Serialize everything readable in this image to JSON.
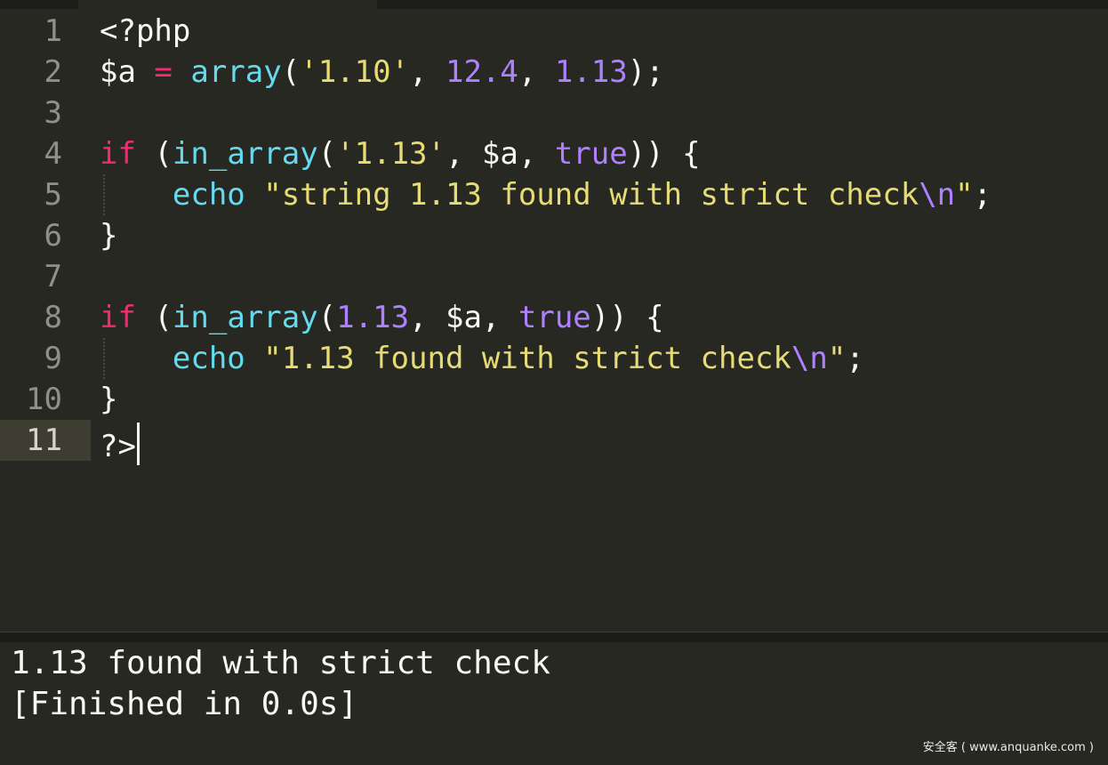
{
  "editor": {
    "active_line": 11,
    "lines": [
      {
        "number": "1",
        "tokens": [
          [
            "plain",
            "<?php"
          ]
        ]
      },
      {
        "number": "2",
        "tokens": [
          [
            "plain",
            "$a "
          ],
          [
            "kw",
            "="
          ],
          [
            "plain",
            " "
          ],
          [
            "fn",
            "array"
          ],
          [
            "plain",
            "("
          ],
          [
            "str",
            "'1.10'"
          ],
          [
            "plain",
            ", "
          ],
          [
            "num",
            "12.4"
          ],
          [
            "plain",
            ", "
          ],
          [
            "num",
            "1.13"
          ],
          [
            "plain",
            ");"
          ]
        ]
      },
      {
        "number": "3",
        "tokens": []
      },
      {
        "number": "4",
        "tokens": [
          [
            "kw",
            "if"
          ],
          [
            "plain",
            " ("
          ],
          [
            "fn",
            "in_array"
          ],
          [
            "plain",
            "("
          ],
          [
            "str",
            "'1.13'"
          ],
          [
            "plain",
            ", $a, "
          ],
          [
            "num",
            "true"
          ],
          [
            "plain",
            ")) {"
          ]
        ]
      },
      {
        "number": "5",
        "indent": true,
        "tokens": [
          [
            "plain",
            "    "
          ],
          [
            "fn",
            "echo"
          ],
          [
            "plain",
            " "
          ],
          [
            "str",
            "\"string 1.13 found with strict check"
          ],
          [
            "esc",
            "\\n"
          ],
          [
            "str",
            "\""
          ],
          [
            "plain",
            ";"
          ]
        ]
      },
      {
        "number": "6",
        "tokens": [
          [
            "plain",
            "}"
          ]
        ]
      },
      {
        "number": "7",
        "tokens": []
      },
      {
        "number": "8",
        "tokens": [
          [
            "kw",
            "if"
          ],
          [
            "plain",
            " ("
          ],
          [
            "fn",
            "in_array"
          ],
          [
            "plain",
            "("
          ],
          [
            "num",
            "1.13"
          ],
          [
            "plain",
            ", $a, "
          ],
          [
            "num",
            "true"
          ],
          [
            "plain",
            ")) {"
          ]
        ]
      },
      {
        "number": "9",
        "indent": true,
        "tokens": [
          [
            "plain",
            "    "
          ],
          [
            "fn",
            "echo"
          ],
          [
            "plain",
            " "
          ],
          [
            "str",
            "\"1.13 found with strict check"
          ],
          [
            "esc",
            "\\n"
          ],
          [
            "str",
            "\""
          ],
          [
            "plain",
            ";"
          ]
        ]
      },
      {
        "number": "10",
        "tokens": [
          [
            "plain",
            "}"
          ]
        ]
      },
      {
        "number": "11",
        "tokens": [
          [
            "plain",
            "?>"
          ]
        ],
        "caret": true
      }
    ]
  },
  "output": {
    "line1": "1.13 found with strict check",
    "line2": "[Finished in 0.0s]"
  },
  "watermark": "安全客 ( www.anquanke.com )",
  "colors": {
    "background": "#272822",
    "keyword": "#f92672",
    "function": "#66d9ef",
    "string": "#e6db74",
    "number": "#ae81ff",
    "text": "#f8f8f2"
  }
}
